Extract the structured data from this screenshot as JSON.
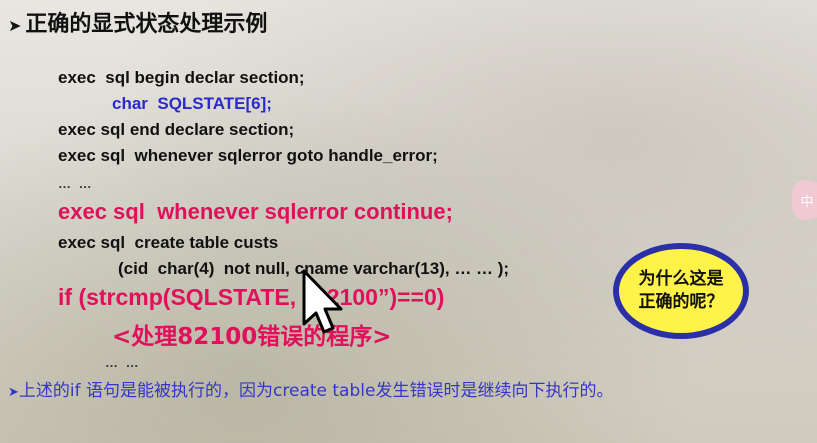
{
  "title": "正确的显式状态处理示例",
  "code": {
    "l1": "exec  sql begin declar section;",
    "l2": "char  SQLSTATE[6];",
    "l3": "exec sql end declare section;",
    "l4": "exec sql  whenever sqlerror goto handle_error;",
    "l5": "… …",
    "l6": "exec sql  whenever sqlerror continue;",
    "l7": "exec sql  create table custs",
    "l8": "(cid  char(4)  not null, cname varchar(13), … … );",
    "l9": "if (strcmp(SQLSTATE, “82100”)==0)",
    "l10": "<处理82100错误的程序>",
    "l11": "… …"
  },
  "bubble": {
    "line1": "为什么这是",
    "line2": "正确的呢？"
  },
  "note": "上述的if 语句是能被执行的，因为create table发生错误时是继续向下执行的。",
  "side_badge": "中",
  "icons": {
    "title_bullet": "arrow-bullet-icon",
    "note_bullet": "arrow-bullet-icon",
    "pointer": "mouse-cursor-icon"
  }
}
